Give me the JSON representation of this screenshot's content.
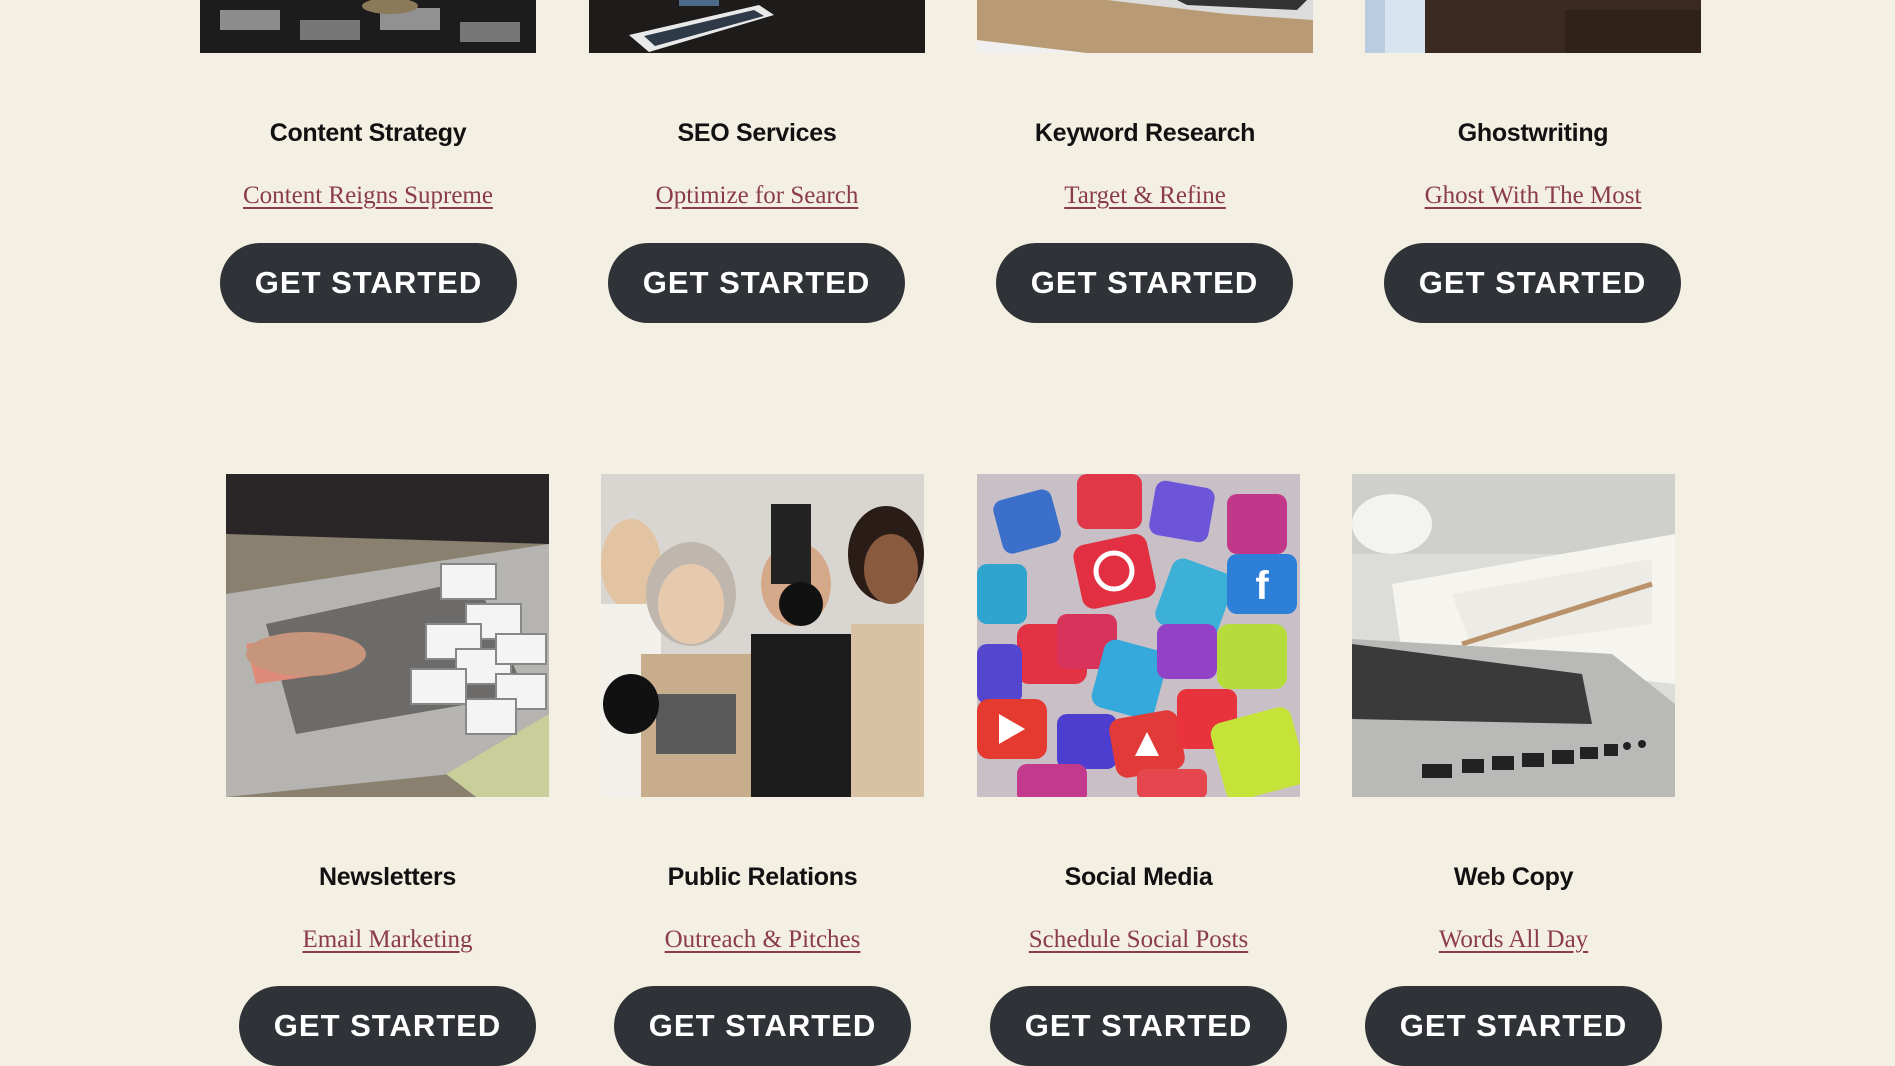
{
  "row1": [
    {
      "title": "Content Strategy",
      "sub": "Content Reigns Supreme",
      "button": "GET STARTED",
      "image": "chess-photo"
    },
    {
      "title": "SEO Services",
      "sub": "Optimize for Search",
      "button": "GET STARTED",
      "image": "tablet-photo"
    },
    {
      "title": "Keyword Research",
      "sub": "Target & Refine",
      "button": "GET STARTED",
      "image": "laptop-desk-photo"
    },
    {
      "title": "Ghostwriting",
      "sub": "Ghost With The Most",
      "button": "GET STARTED",
      "image": "desk-photo"
    }
  ],
  "row2": [
    {
      "title": "Newsletters",
      "sub": "Email Marketing",
      "button": "GET STARTED",
      "image": "email-laptop-photo"
    },
    {
      "title": "Public Relations",
      "sub": "Outreach & Pitches",
      "button": "GET STARTED",
      "image": "press-reporters-photo"
    },
    {
      "title": "Social Media",
      "sub": "Schedule Social Posts",
      "button": "GET STARTED",
      "image": "social-icons-photo"
    },
    {
      "title": "Web Copy",
      "sub": "Words All Day",
      "button": "GET STARTED",
      "image": "notebook-laptop-photo"
    }
  ],
  "colors": {
    "background": "#f4efe3",
    "button": "#2f3236",
    "link": "#8a3b4d"
  }
}
